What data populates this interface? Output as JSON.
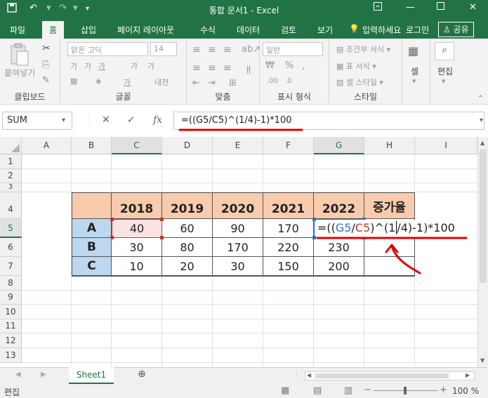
{
  "window": {
    "title": "통합 문서1 - Excel"
  },
  "ribbon_tabs": [
    "파일",
    "홈",
    "삽입",
    "페이지 레이아웃",
    "수식",
    "데이터",
    "검토",
    "보기"
  ],
  "tell_me": "입력하세요",
  "login": "로그인",
  "share": "공유",
  "ribbon": {
    "clipboard": {
      "paste": "붙여넣기",
      "label": "클립보드"
    },
    "font": {
      "name": "맑은 고딕",
      "size": "14",
      "label": "글꼴"
    },
    "align": {
      "label": "맞춤",
      "wrap": "ㅐ"
    },
    "number": {
      "format": "일반",
      "label": "표시 형식"
    },
    "styles": {
      "conditional": "조건부 서식",
      "table": "표 서식",
      "cell": "셀 스타일",
      "label": "스타일"
    },
    "cells": {
      "label": "셀"
    },
    "editing": {
      "label": "편집"
    }
  },
  "formula_bar": {
    "name_box": "SUM",
    "fx": "fx",
    "formula": "=((G5/C5)^(1/4)-1)*100"
  },
  "columns": [
    "A",
    "B",
    "C",
    "D",
    "E",
    "F",
    "G",
    "H",
    "I"
  ],
  "rows": [
    "1",
    "2",
    "3",
    "4",
    "5",
    "6",
    "7",
    "8",
    "9",
    "10",
    "11",
    "12",
    "13"
  ],
  "table": {
    "headers": [
      "2018",
      "2019",
      "2020",
      "2021",
      "2022",
      "증가율"
    ],
    "rows": [
      {
        "label": "A",
        "values": [
          "40",
          "60",
          "90",
          "170"
        ]
      },
      {
        "label": "B",
        "values": [
          "30",
          "80",
          "170",
          "220",
          "230"
        ]
      },
      {
        "label": "C",
        "values": [
          "10",
          "20",
          "30",
          "150",
          "200"
        ]
      }
    ],
    "editing_formula": {
      "p1": "=((",
      "g5": "G5",
      "slash": "/",
      "c5": "C5",
      "p2": ")^(",
      "one": "1",
      "rest": "/4)-1)*100"
    }
  },
  "sheet_tab": "Sheet1",
  "status": {
    "mode": "편집",
    "zoom": "100 %"
  },
  "colors": {
    "accent": "#217346",
    "header_fill": "#f8cbad",
    "label_fill": "#bdd7ee",
    "annotation": "#e00000",
    "ref_blue": "#3a6fc4",
    "ref_red": "#c0392b"
  }
}
